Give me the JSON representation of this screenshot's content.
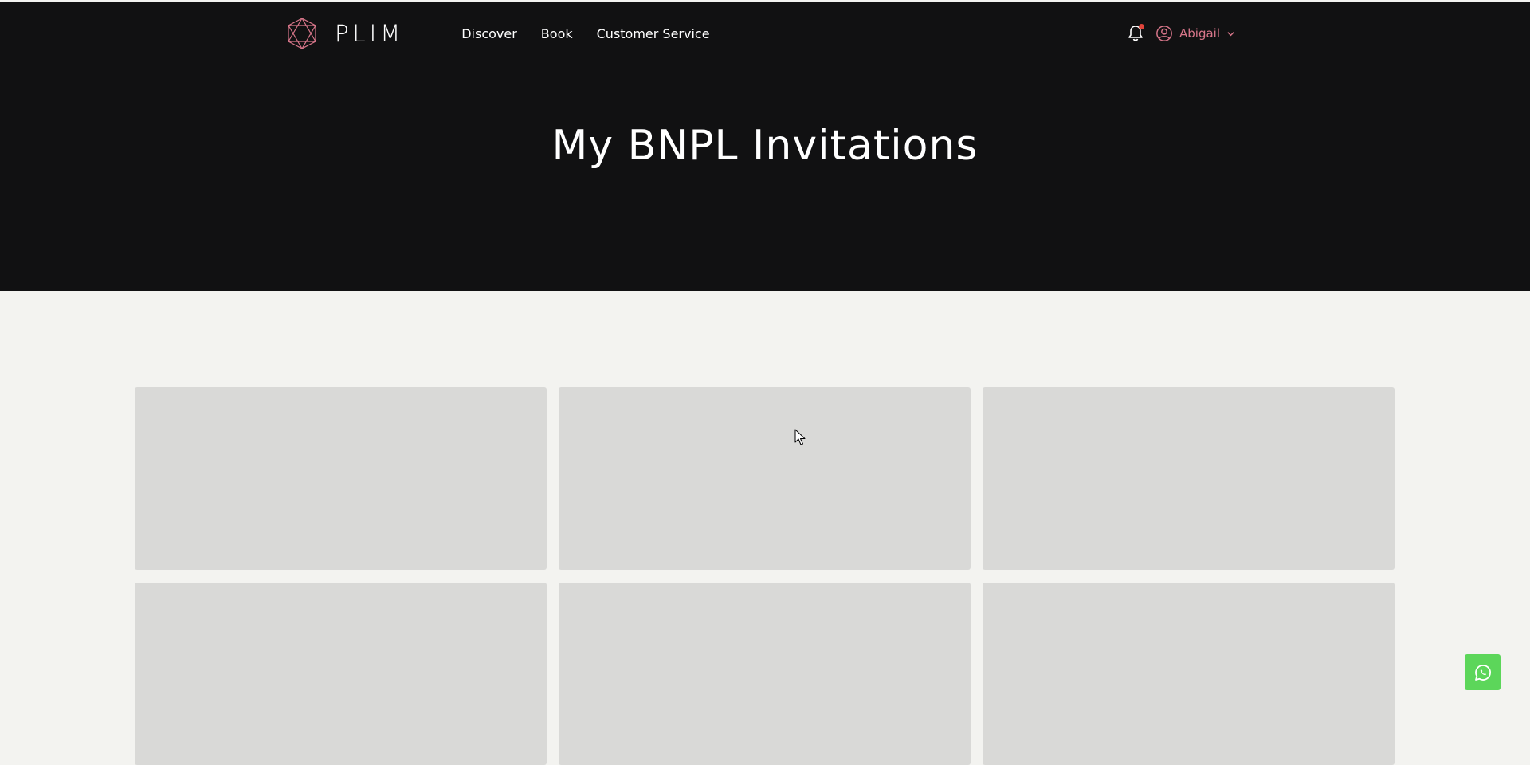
{
  "header": {
    "brand": "PLIM",
    "nav": [
      {
        "label": "Discover"
      },
      {
        "label": "Book"
      },
      {
        "label": "Customer Service"
      }
    ],
    "user": {
      "name": "Abigail"
    },
    "icons": {
      "logo": "plim-logo-icon",
      "bell": "bell-icon",
      "user": "user-circle-icon",
      "chevron": "chevron-down-icon"
    }
  },
  "hero": {
    "title": "My BNPL Invitations"
  },
  "cards": [
    {
      "state": "loading-placeholder"
    },
    {
      "state": "loading-placeholder"
    },
    {
      "state": "loading-placeholder"
    },
    {
      "state": "loading-placeholder"
    },
    {
      "state": "loading-placeholder"
    },
    {
      "state": "loading-placeholder"
    }
  ],
  "floating": {
    "icon": "whatsapp-icon"
  },
  "colors": {
    "hero_bg": "#111112",
    "page_bg": "#f3f3f0",
    "card_bg": "#d9d9d7",
    "accent": "#d8768a",
    "notification_dot": "#e0443b",
    "whatsapp": "#5cd65a"
  }
}
